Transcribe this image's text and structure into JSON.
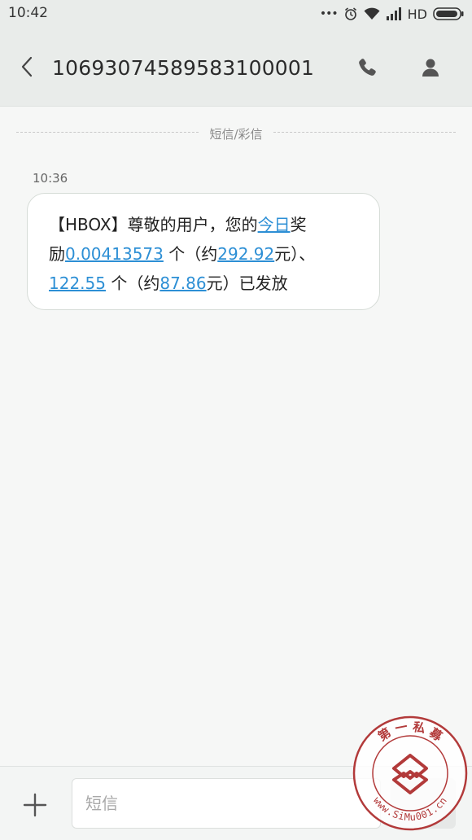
{
  "status_bar": {
    "time": "10:42",
    "dots": "•••",
    "network": "HD"
  },
  "header": {
    "sender": "10693074589583100001",
    "icons": [
      "back-arrow-icon",
      "phone-icon",
      "contact-icon"
    ]
  },
  "divider": {
    "label": "短信/彩信"
  },
  "message": {
    "time": "10:36",
    "segments": {
      "s1": "【HBOX】尊敬的用户，您的",
      "link_today": "今日",
      "s2": "奖",
      "s3": "励",
      "link_amount1": "0.00413573",
      "s4": " 个（约",
      "link_value1": "292.92",
      "s5": "元）、",
      "link_amount2": "122.55",
      "s6": " 个（约",
      "link_value2": "87.86",
      "s7": "元）已发放"
    }
  },
  "input_bar": {
    "placeholder": "短信"
  },
  "watermark": {
    "top_text": "第 一 私 募",
    "bottom_text": "www.SiMu001.cn"
  },
  "colors": {
    "link": "#2d8fd5",
    "bar_bg": "#e9ecea",
    "page_bg": "#f6f7f6",
    "watermark": "#b23a3a"
  }
}
